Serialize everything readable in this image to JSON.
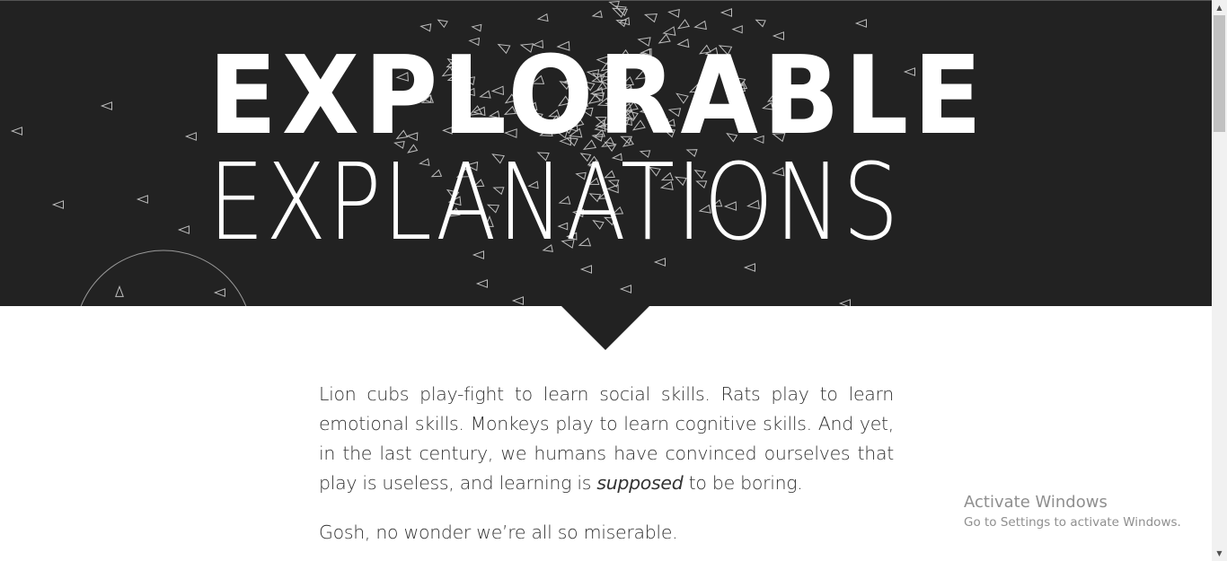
{
  "hero": {
    "title_bold": "EXPLORABLE",
    "title_light": "EXPLANATIONS",
    "background_color": "#222222"
  },
  "content": {
    "paragraph1_part1": "Lion cubs play-fight to learn social skills. Rats play to learn emotional skills. Monkeys play to learn cognitive skills. And yet, in the last century, we humans have convinced ourselves that play is useless, and learning is ",
    "paragraph1_emphasis": "supposed",
    "paragraph1_part2": " to be boring.",
    "paragraph2": "Gosh, no wonder we’re all so miserable."
  },
  "watermark": {
    "title": "Activate Windows",
    "subtitle": "Go to Settings to activate Windows."
  },
  "scrollbar": {
    "up_icon": "scroll-up-arrow-icon",
    "down_icon": "scroll-down-arrow-icon"
  }
}
